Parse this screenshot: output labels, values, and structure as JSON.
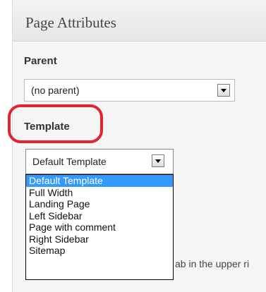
{
  "panel": {
    "title": "Page Attributes"
  },
  "parent": {
    "label": "Parent",
    "selected": "(no parent)"
  },
  "template": {
    "label": "Template",
    "selected": "Default Template",
    "options": [
      "Default Template",
      "Full Width",
      "Landing Page",
      "Left Sidebar",
      "Page with comment",
      "Right Sidebar",
      "Sitemap"
    ]
  },
  "partial": {
    "behind_text": "ab in the upper ri"
  },
  "colors": {
    "highlight": "#e0252f",
    "selection": "#3399ff"
  },
  "icons": {
    "select_arrow": "chevron-down-icon"
  }
}
